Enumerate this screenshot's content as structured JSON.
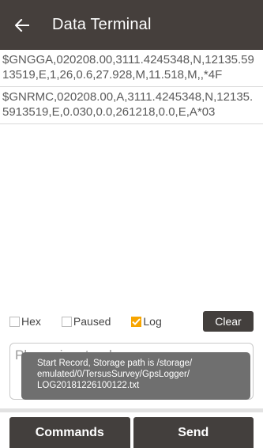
{
  "header": {
    "title": "Data Terminal",
    "back_icon": "arrow-left-icon"
  },
  "log": {
    "lines": [
      "$GNGGA,020208.00,3111.4245348,N,12135.5913519,E,1,26,0.6,27.928,M,11.518,M,,*4F",
      "$GNRMC,020208.00,A,3111.4245348,N,12135.5913519,E,0.030,0.0,261218,0.0,E,A*03"
    ]
  },
  "controls": {
    "hex": {
      "label": "Hex",
      "checked": false
    },
    "paused": {
      "label": "Paused",
      "checked": false
    },
    "log": {
      "label": "Log",
      "checked": true
    },
    "clear_label": "Clear"
  },
  "input": {
    "placeholder": "Please input order",
    "value": ""
  },
  "toast": {
    "line1": "Start Record, Storage path is /storage/",
    "line2": "emulated/0/TersusSurvey/GpsLogger/",
    "line3": "LOG20181226100122.txt"
  },
  "buttons": {
    "commands_label": "Commands",
    "send_label": "Send"
  },
  "colors": {
    "appbar": "#453f3c",
    "button": "#433f3d",
    "checkbox_accent": "#f7a500",
    "toast": "#6f6f6f"
  }
}
